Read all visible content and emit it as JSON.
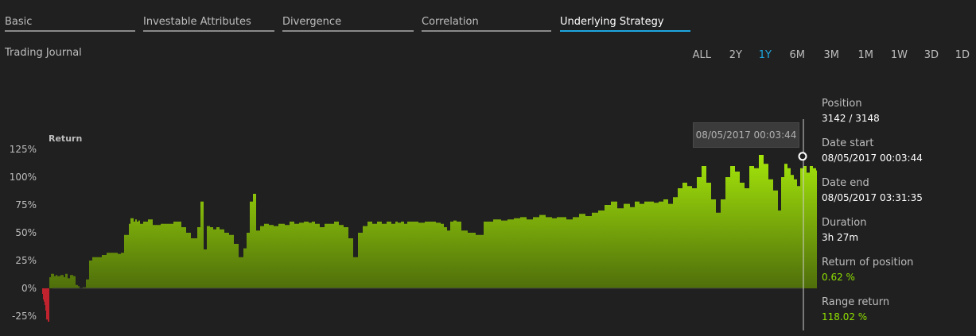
{
  "tabs": [
    {
      "label": "Basic",
      "active": false
    },
    {
      "label": "Investable Attributes",
      "active": false
    },
    {
      "label": "Divergence",
      "active": false
    },
    {
      "label": "Correlation",
      "active": false
    },
    {
      "label": "Underlying Strategy",
      "active": true
    }
  ],
  "subtitle": "Trading Journal",
  "time_ranges": [
    {
      "label": "ALL",
      "active": false
    },
    {
      "label": "2Y",
      "active": false
    },
    {
      "label": "1Y",
      "active": true
    },
    {
      "label": "6M",
      "active": false
    },
    {
      "label": "3M",
      "active": false
    },
    {
      "label": "1M",
      "active": false
    },
    {
      "label": "1W",
      "active": false
    },
    {
      "label": "3D",
      "active": false
    },
    {
      "label": "1D",
      "active": false
    }
  ],
  "tooltip": {
    "text": "08/05/2017 00:03:44"
  },
  "info": {
    "position_label": "Position",
    "position_value": "3142 / 3148",
    "date_start_label": "Date start",
    "date_start_value": "08/05/2017 00:03:44",
    "date_end_label": "Date end",
    "date_end_value": "08/05/2017 03:31:35",
    "duration_label": "Duration",
    "duration_value": "3h 27m",
    "return_position_label": "Return of position",
    "return_position_value": "0.62 %",
    "range_return_label": "Range return",
    "range_return_value": "118.02 %"
  },
  "colors": {
    "accent": "#1ea7e1",
    "positive": "#8fe000",
    "negative": "#c0232d",
    "area_top": "#a6e80a",
    "area_bottom": "#4f6e0b"
  },
  "chart_data": {
    "type": "area",
    "ylabel": "Return",
    "yticks": [
      "125%",
      "100%",
      "75%",
      "50%",
      "25%",
      "0%",
      "-25%"
    ],
    "ylim": [
      -30,
      130
    ],
    "x": [
      0,
      1,
      2,
      3,
      4,
      5,
      6,
      8,
      10,
      12,
      16,
      18,
      20,
      24,
      28,
      30,
      33,
      36,
      40,
      43,
      46,
      48,
      52,
      56,
      60,
      64,
      70,
      76,
      82,
      90,
      96,
      100,
      104,
      108,
      110,
      112,
      114,
      116,
      118,
      120,
      122,
      124,
      128,
      134,
      140,
      150,
      156,
      166,
      176,
      182,
      188,
      196,
      200,
      204,
      208,
      212,
      216,
      220,
      224,
      230,
      236,
      242,
      248,
      254,
      258,
      262,
      266,
      270,
      275,
      280,
      286,
      292,
      298,
      306,
      312,
      318,
      324,
      330,
      336,
      340,
      344,
      350,
      356,
      362,
      368,
      374,
      380,
      386,
      392,
      398,
      404,
      410,
      416,
      422,
      428,
      434,
      440,
      445,
      448,
      452,
      456,
      460,
      466,
      474,
      482,
      490,
      496,
      502,
      506,
      510,
      514,
      518,
      522,
      528,
      536,
      546,
      556,
      568,
      578,
      586,
      594,
      602,
      610,
      618,
      626,
      634,
      642,
      648,
      654,
      660,
      668,
      676,
      684,
      692,
      700,
      708,
      716,
      724,
      732,
      740,
      746,
      752,
      758,
      764,
      770,
      776,
      782,
      788,
      794,
      800,
      806,
      812,
      818,
      824,
      830,
      836,
      842,
      848,
      854,
      860,
      866,
      872,
      878,
      884,
      890,
      896,
      902,
      908,
      914,
      920,
      926,
      930,
      934,
      938,
      942,
      946,
      950,
      954,
      958,
      962,
      966,
      970,
      974,
      978,
      982,
      986,
      990,
      994,
      998,
      1002,
      1006,
      1010
    ],
    "values": [
      0,
      -5,
      -10,
      -12,
      -15,
      -20,
      -28,
      -30,
      10,
      13,
      11,
      12,
      11,
      12,
      10,
      13,
      9,
      12,
      11,
      3,
      2,
      0,
      1,
      8,
      25,
      28,
      28,
      30,
      32,
      32,
      31,
      32,
      48,
      48,
      58,
      63,
      63,
      60,
      62,
      60,
      61,
      58,
      60,
      62,
      57,
      58,
      58,
      60,
      55,
      50,
      45,
      55,
      78,
      35,
      56,
      55,
      53,
      55,
      53,
      50,
      48,
      40,
      28,
      36,
      50,
      78,
      85,
      52,
      56,
      58,
      57,
      56,
      58,
      57,
      60,
      58,
      59,
      60,
      59,
      60,
      58,
      55,
      58,
      58,
      60,
      57,
      55,
      45,
      28,
      50,
      56,
      60,
      58,
      60,
      58,
      60,
      58,
      60,
      59,
      60,
      58,
      60,
      60,
      59,
      60,
      60,
      59,
      58,
      55,
      52,
      60,
      61,
      60,
      52,
      50,
      48,
      60,
      62,
      61,
      62,
      63,
      64,
      62,
      64,
      66,
      64,
      63,
      64,
      64,
      62,
      64,
      67,
      65,
      68,
      70,
      75,
      78,
      72,
      76,
      73,
      78,
      76,
      78,
      78,
      77,
      78,
      80,
      76,
      82,
      90,
      95,
      92,
      90,
      100,
      110,
      95,
      80,
      68,
      80,
      100,
      110,
      105,
      95,
      90,
      110,
      108,
      120,
      112,
      98,
      88,
      70,
      100,
      112,
      108,
      102,
      98,
      92,
      108,
      110,
      104,
      110,
      108,
      106,
      114,
      118,
      112,
      110,
      116,
      118,
      122,
      118
    ]
  }
}
